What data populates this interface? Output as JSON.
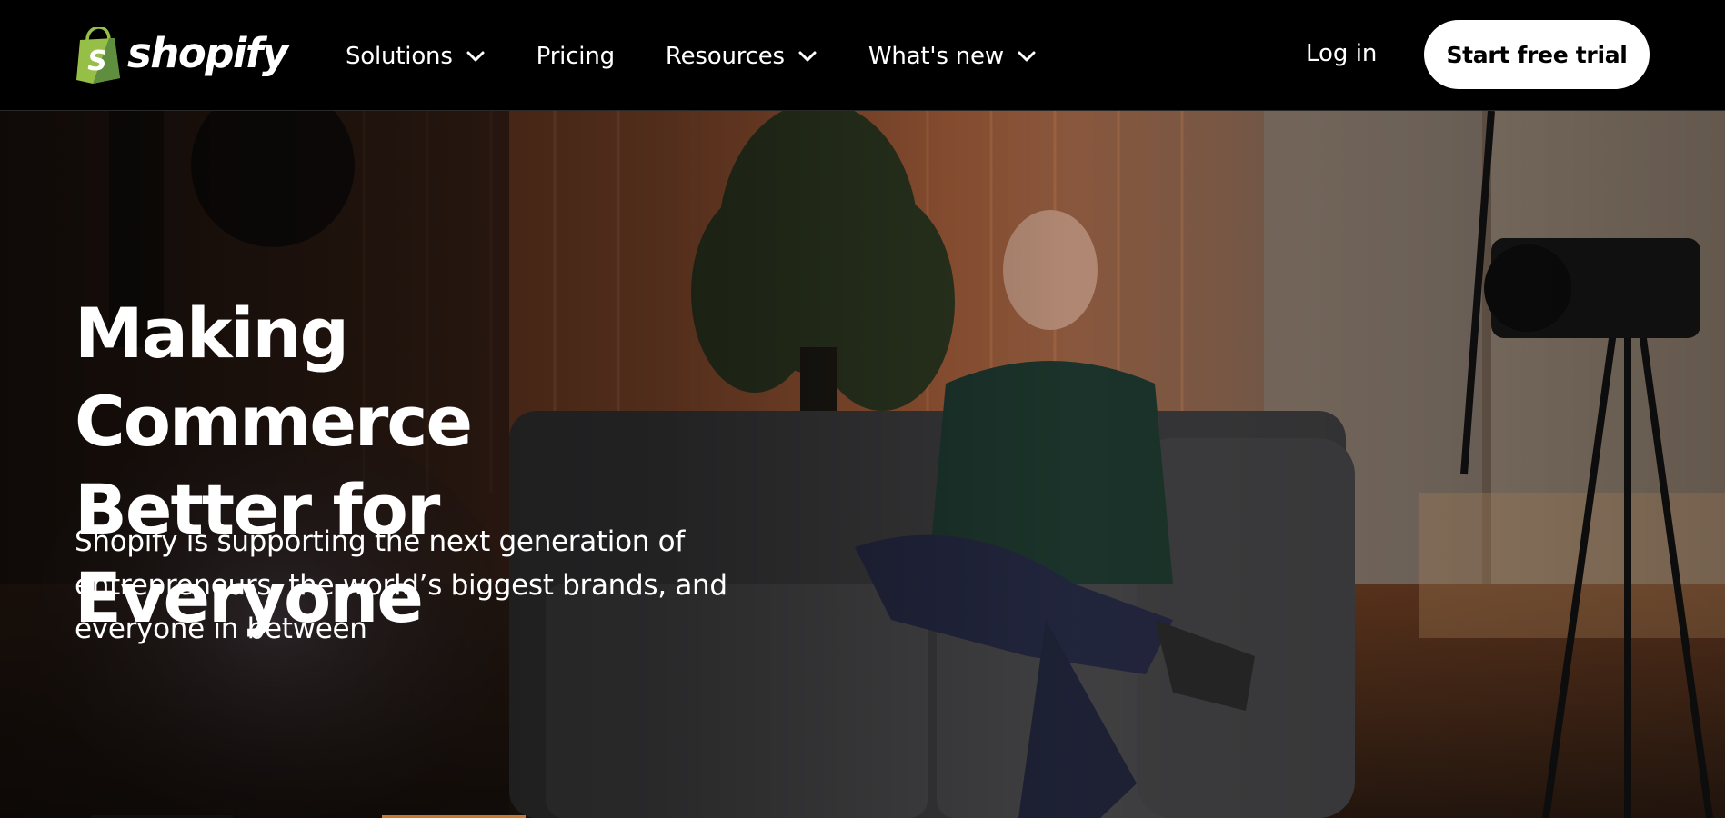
{
  "brand": {
    "name": "shopify",
    "logo_color": "#95bf47",
    "logo_dark": "#5e8e3e"
  },
  "nav": {
    "items": [
      {
        "label": "Solutions",
        "has_dropdown": true
      },
      {
        "label": "Pricing",
        "has_dropdown": false
      },
      {
        "label": "Resources",
        "has_dropdown": true
      },
      {
        "label": "What's new",
        "has_dropdown": true
      }
    ],
    "login_label": "Log in",
    "cta_label": "Start free trial"
  },
  "hero": {
    "title_line1": "Making Commerce",
    "title_line2": "Better for Everyone",
    "subtitle": "Shopify is supporting the next generation of entrepreneurs, the world’s biggest brands, and everyone in between",
    "background": "video-still-man-on-sofa-in-studio"
  },
  "icons": {
    "logo": "shopping-bag-icon",
    "dropdown": "chevron-down-icon"
  }
}
